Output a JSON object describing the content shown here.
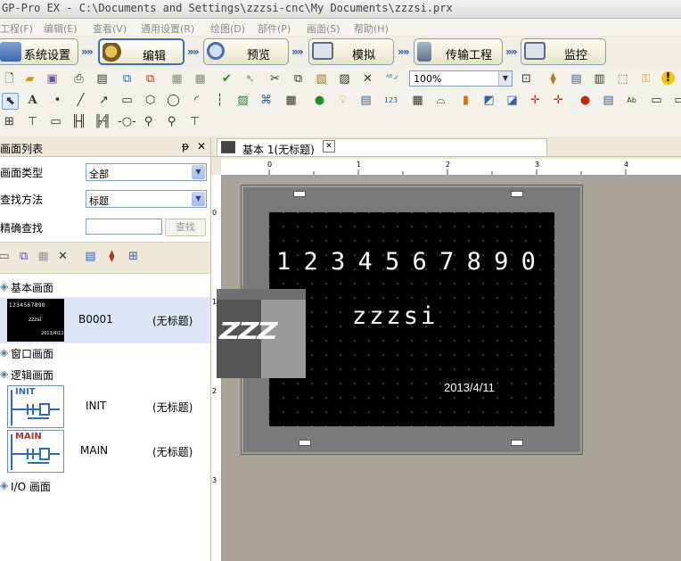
{
  "window": {
    "title": "GP-Pro EX - C:\\Documents and Settings\\zzzsi-cnc\\My Documents\\zzzsi.prx"
  },
  "menu": [
    "工程(F)",
    "编辑(E)",
    "查看(V)",
    "通用设置(R)",
    "绘图(D)",
    "部件(P)",
    "画面(S)",
    "帮助(H)"
  ],
  "workflow": {
    "items": [
      {
        "label": "系统设置",
        "icon": "system-settings-icon"
      },
      {
        "label": "编辑",
        "icon": "edit-palette-icon",
        "active": true
      },
      {
        "label": "预览",
        "icon": "preview-magnifier-icon"
      },
      {
        "label": "模拟",
        "icon": "simulation-monitor-icon"
      },
      {
        "label": "传输工程",
        "icon": "transfer-project-icon"
      },
      {
        "label": "监控",
        "icon": "monitor-icon"
      }
    ],
    "separator": "»"
  },
  "toolbar": {
    "zoom_value": "100%"
  },
  "panel": {
    "title": "画面列表",
    "pin_glyph": "ᵽ",
    "close_glyph": "✕",
    "screen_type_label": "画面类型",
    "screen_type_value": "全部",
    "search_method_label": "查找方法",
    "search_method_value": "标题",
    "exact_search_label": "精确查找",
    "exact_search_value": "",
    "search_button": "查找",
    "tree": {
      "base": {
        "label": "基本画面",
        "items": [
          {
            "id": "B0001",
            "title": "(无标题)"
          }
        ]
      },
      "window": {
        "label": "窗口画面"
      },
      "logic": {
        "label": "逻辑画面",
        "items": [
          {
            "id": "INIT",
            "title": "(无标题)"
          },
          {
            "id": "MAIN",
            "title": "(无标题)"
          }
        ]
      },
      "io": {
        "label": "I/O 画面"
      }
    }
  },
  "editor": {
    "tab_label": "基本 1(无标题)",
    "tab_close": "✕",
    "ruler_top_labels": [
      "0",
      "1",
      "2",
      "3",
      "4"
    ],
    "ruler_left_labels": [
      "0",
      "1",
      "2",
      "3"
    ],
    "screen": {
      "digits": "1 2 3 4 5 6 7 8 9 0",
      "name_text": "zzzsi",
      "date_text": "2013/4/11",
      "logo_text": "ZZZ"
    },
    "thumb_text": "1234567890"
  }
}
